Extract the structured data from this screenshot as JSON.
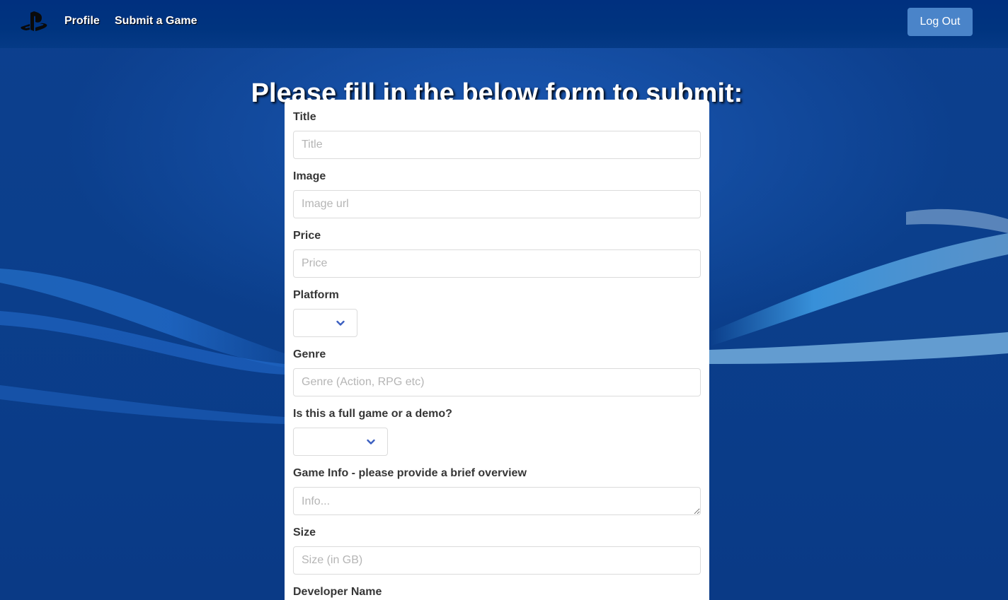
{
  "colors": {
    "navbar": "#00307f",
    "background": "#0b3f8c",
    "logout_button": "#4a84c9",
    "chevron": "#3b5fc0",
    "wave_highlight": "#4db8ff"
  },
  "navbar": {
    "logo_icon": "playstation-logo-icon",
    "links": [
      {
        "label": "Profile"
      },
      {
        "label": "Submit a Game"
      }
    ],
    "logout_label": "Log Out"
  },
  "page": {
    "heading": "Please fill in the below form to submit:"
  },
  "form": {
    "title": {
      "label": "Title",
      "placeholder": "Title",
      "value": ""
    },
    "image": {
      "label": "Image",
      "placeholder": "Image url",
      "value": ""
    },
    "price": {
      "label": "Price",
      "placeholder": "Price",
      "value": ""
    },
    "platform": {
      "label": "Platform",
      "selected": ""
    },
    "genre": {
      "label": "Genre",
      "placeholder": "Genre (Action, RPG etc)",
      "value": ""
    },
    "game_type": {
      "label": "Is this a full game or a demo?",
      "selected": ""
    },
    "info": {
      "label": "Game Info - please provide a brief overview",
      "placeholder": "Info...",
      "value": ""
    },
    "size": {
      "label": "Size",
      "placeholder": "Size (in GB)",
      "value": ""
    },
    "developer": {
      "label": "Developer Name"
    }
  }
}
